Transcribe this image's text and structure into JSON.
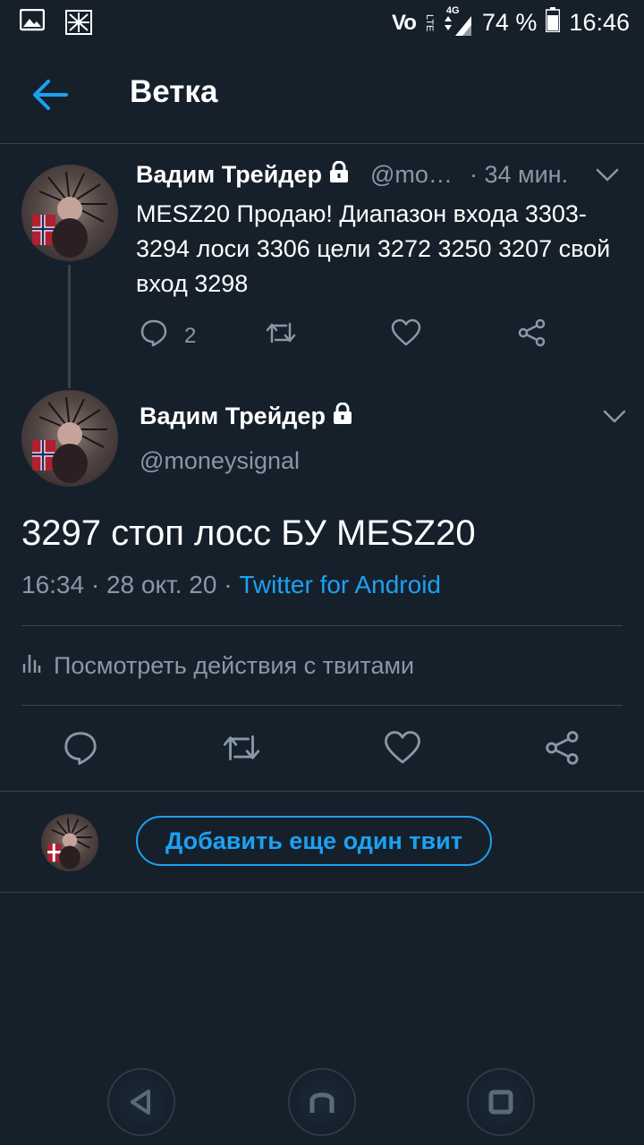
{
  "status_bar": {
    "network": "Vo",
    "lte": "LTE",
    "net_type": "4G",
    "battery": "74 %",
    "time": "16:46"
  },
  "header": {
    "title": "Ветка"
  },
  "tweet1": {
    "name": "Вадим Трейдер",
    "handle": "@mo…",
    "time": "· 34 мин.",
    "text": "MESZ20 Продаю! Диапазон входа 3303-3294 лоси 3306 цели 3272 3250 3207 свой вход 3298",
    "reply_count": "2"
  },
  "tweet2": {
    "name": "Вадим Трейдер",
    "handle": "@moneysignal",
    "text": "3297 стоп лосс БУ MESZ20",
    "datetime": "16:34 · 28 окт. 20 ·",
    "source": "Twitter for Android"
  },
  "activity": {
    "label": "Посмотреть действия с твитами"
  },
  "reply_bar": {
    "add_button": "Добавить еще один твит"
  },
  "colors": {
    "background": "#15202b",
    "accent": "#1da1f2",
    "muted": "#8899a6",
    "divider": "#38444d"
  },
  "icons": [
    "gallery-icon",
    "notification-icon",
    "back-arrow-icon",
    "lock-icon",
    "chevron-down-icon",
    "reply-icon",
    "retweet-icon",
    "like-icon",
    "share-icon",
    "stats-icon",
    "nav-back-icon",
    "nav-home-icon",
    "nav-recents-icon"
  ]
}
